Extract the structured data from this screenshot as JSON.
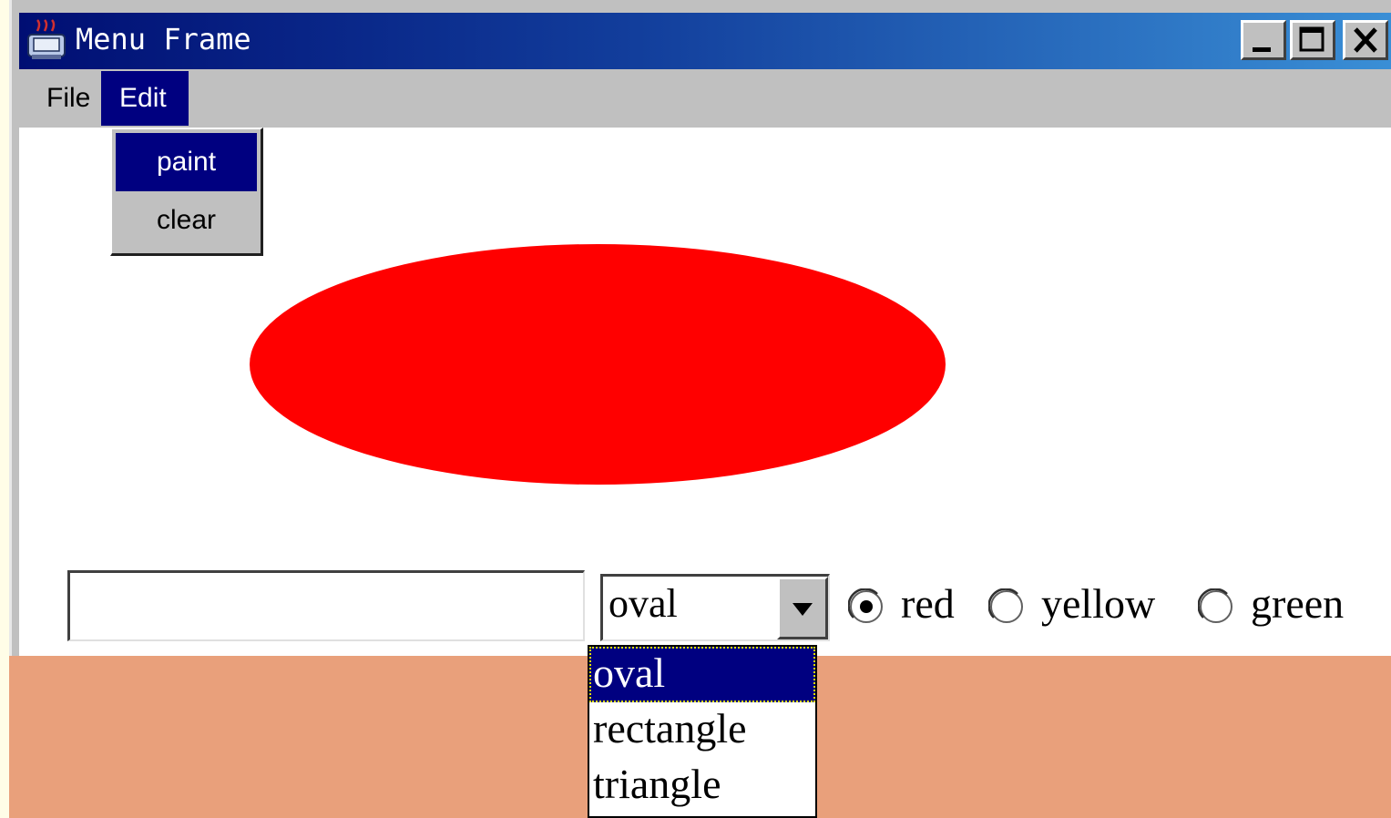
{
  "window": {
    "title": "Menu Frame",
    "controls": [
      "minimize",
      "maximize",
      "close"
    ]
  },
  "menubar": {
    "items": [
      {
        "label": "File",
        "active": false
      },
      {
        "label": "Edit",
        "active": true
      }
    ]
  },
  "edit_menu": {
    "items": [
      {
        "label": "paint",
        "selected": true
      },
      {
        "label": "clear",
        "selected": false
      }
    ]
  },
  "canvas": {
    "shape": "oval",
    "fill_color": "#FF0000"
  },
  "controls": {
    "text_input_value": "",
    "shape_select": {
      "value": "oval",
      "options": [
        "oval",
        "rectangle",
        "triangle"
      ],
      "open": true
    },
    "color_radios": [
      {
        "label": "red",
        "checked": true
      },
      {
        "label": "yellow",
        "checked": false
      },
      {
        "label": "green",
        "checked": false
      }
    ]
  },
  "colors": {
    "titlebar_start": "#000E73",
    "titlebar_end": "#3A8FD6",
    "selection": "#000080",
    "panel": "#C0C0C0",
    "slide_band": "#E9A07B"
  },
  "icons": {
    "app": "java-cup-icon",
    "minimize": "minimize-icon",
    "maximize": "maximize-icon",
    "close": "close-icon",
    "dropdown": "chevron-down-icon"
  }
}
